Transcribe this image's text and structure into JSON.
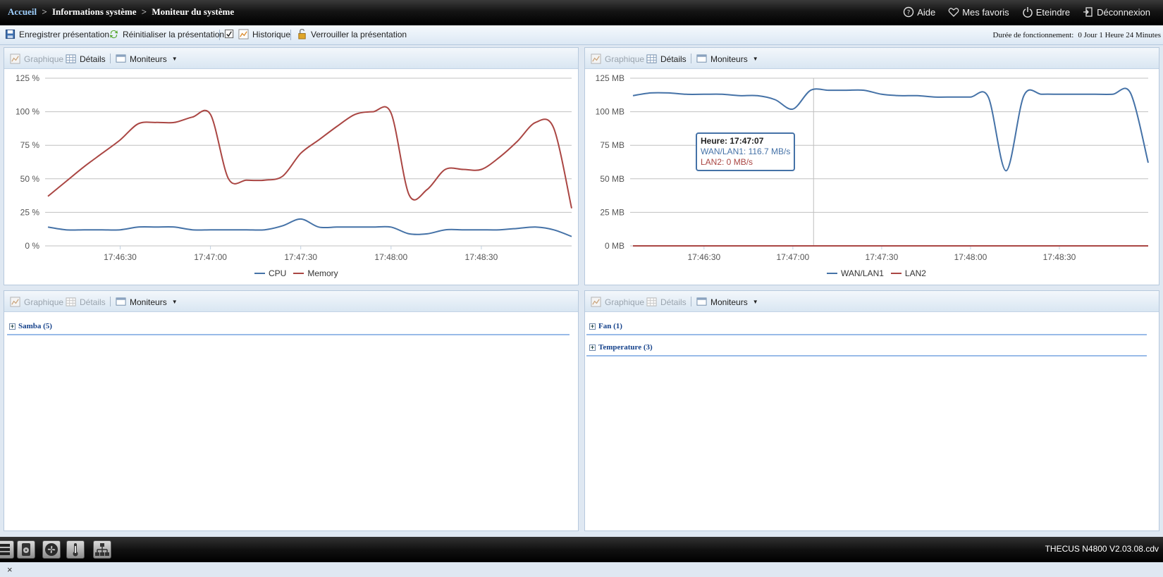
{
  "header": {
    "breadcrumb": {
      "home": "Accueil",
      "sep": ">",
      "level1": "Informations système",
      "level2": "Moniteur du système"
    },
    "nav": [
      {
        "label": "Aide",
        "icon": "help-icon"
      },
      {
        "label": "Mes favoris",
        "icon": "heart-icon"
      },
      {
        "label": "Eteindre",
        "icon": "power-icon"
      },
      {
        "label": "Déconnexion",
        "icon": "logout-icon"
      }
    ]
  },
  "toolbar": {
    "save_label": "Enregistrer présentation",
    "reset_label": "Réinitialiser la présentation",
    "history_label": "Historique",
    "history_checked": true,
    "lock_label": "Verrouiller la présentation",
    "uptime_label": "Durée de fonctionnement:",
    "uptime_value": "0 Jour 1 Heure 24 Minutes"
  },
  "panel_toolbar": {
    "graph": "Graphique",
    "details": "Détails",
    "monitors": "Moniteurs"
  },
  "colors": {
    "blue": "#4572a7",
    "red": "#aa4643",
    "accent": "#15428b"
  },
  "chart_data": [
    {
      "type": "line",
      "x_ticks": [
        "17:46:30",
        "17:47:00",
        "17:47:30",
        "17:48:00",
        "17:48:30"
      ],
      "y_ticks": [
        "125 %",
        "100 %",
        "75 %",
        "50 %",
        "25 %",
        "0 %"
      ],
      "ylim": [
        0,
        125
      ],
      "x": [
        "17:46:06",
        "17:46:12",
        "17:46:18",
        "17:46:24",
        "17:46:30",
        "17:46:36",
        "17:46:42",
        "17:46:48",
        "17:46:54",
        "17:47:00",
        "17:47:06",
        "17:47:12",
        "17:47:18",
        "17:47:24",
        "17:47:30",
        "17:47:36",
        "17:47:42",
        "17:47:48",
        "17:47:54",
        "17:48:00",
        "17:48:06",
        "17:48:12",
        "17:48:18",
        "17:48:24",
        "17:48:30",
        "17:48:36",
        "17:48:42",
        "17:48:48",
        "17:48:54",
        "17:49:00"
      ],
      "series": [
        {
          "name": "CPU",
          "color": "#4572a7",
          "values": [
            14,
            12,
            12,
            12,
            12,
            14,
            14,
            14,
            12,
            12,
            12,
            12,
            12,
            15,
            20,
            14,
            14,
            14,
            14,
            14,
            9,
            9,
            12,
            12,
            12,
            12,
            13,
            14,
            12,
            7
          ]
        },
        {
          "name": "Memory",
          "color": "#aa4643",
          "values": [
            37,
            48,
            59,
            69,
            79,
            91,
            92,
            92,
            96,
            98,
            50,
            49,
            49,
            52,
            69,
            79,
            89,
            98,
            100,
            99,
            38,
            42,
            57,
            57,
            57,
            66,
            78,
            92,
            88,
            28
          ]
        }
      ],
      "legend": "bottom-center",
      "grid": true
    },
    {
      "type": "line",
      "x_ticks": [
        "17:46:30",
        "17:47:00",
        "17:47:30",
        "17:48:00",
        "17:48:30"
      ],
      "y_ticks": [
        "125 MB",
        "100 MB",
        "75 MB",
        "50 MB",
        "25 MB",
        "0 MB"
      ],
      "ylim": [
        0,
        125
      ],
      "x": [
        "17:46:06",
        "17:46:12",
        "17:46:18",
        "17:46:24",
        "17:46:30",
        "17:46:36",
        "17:46:42",
        "17:46:48",
        "17:46:54",
        "17:47:00",
        "17:47:06",
        "17:47:12",
        "17:47:18",
        "17:47:24",
        "17:47:30",
        "17:47:36",
        "17:47:42",
        "17:47:48",
        "17:47:54",
        "17:48:00",
        "17:48:06",
        "17:48:12",
        "17:48:18",
        "17:48:24",
        "17:48:30",
        "17:48:36",
        "17:48:42",
        "17:48:48",
        "17:48:54",
        "17:49:00"
      ],
      "series": [
        {
          "name": "WAN/LAN1",
          "color": "#4572a7",
          "values": [
            112,
            114,
            114,
            113,
            113,
            113,
            112,
            112,
            109,
            102,
            116,
            116,
            116,
            116,
            113,
            112,
            112,
            111,
            111,
            111,
            111,
            56,
            112,
            113,
            113,
            113,
            113,
            113,
            114,
            62
          ]
        },
        {
          "name": "LAN2",
          "color": "#aa4643",
          "values": [
            0,
            0,
            0,
            0,
            0,
            0,
            0,
            0,
            0,
            0,
            0,
            0,
            0,
            0,
            0,
            0,
            0,
            0,
            0,
            0,
            0,
            0,
            0,
            0,
            0,
            0,
            0,
            0,
            0,
            0
          ]
        }
      ],
      "legend": "bottom-center",
      "grid": true,
      "tooltip": {
        "title": "Heure: 17:47:07",
        "line1": "WAN/LAN1: 116.7 MB/s",
        "line2": "LAN2: 0 MB/s",
        "at_x": "17:47:07"
      }
    }
  ],
  "tables": {
    "left": [
      {
        "label": "Samba (5)"
      }
    ],
    "right": [
      {
        "label": "Fan (1)"
      },
      {
        "label": "Temperature (3)"
      }
    ]
  },
  "footer": {
    "version": "THECUS N4800 V2.03.08.cdv",
    "dock_icons": [
      "server-icon",
      "disk-icon",
      "fan-icon",
      "thermometer-icon",
      "network-icon"
    ],
    "close": "×"
  }
}
